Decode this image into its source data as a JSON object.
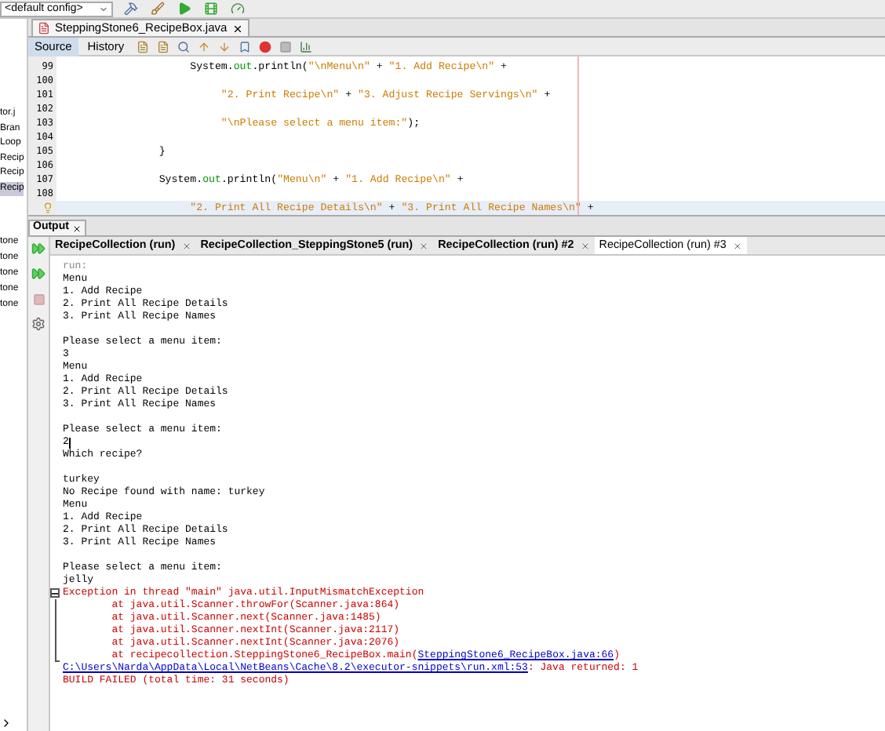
{
  "toolbar": {
    "config": "<default config>"
  },
  "project_tree": {
    "items": [
      {
        "label": "tor.j",
        "selected": false
      },
      {
        "label": "Bran",
        "selected": false
      },
      {
        "label": "Loop",
        "selected": false
      },
      {
        "label": "Recip",
        "selected": false
      },
      {
        "label": "Recip",
        "selected": false
      },
      {
        "label": "Recip",
        "selected": true
      }
    ],
    "lower_items": [
      "tone",
      "tone",
      "tone",
      "tone",
      "tone"
    ]
  },
  "editor": {
    "tab": "SteppingStone6_RecipeBox.java",
    "views": [
      {
        "label": "Source",
        "selected": true
      },
      {
        "label": "History",
        "selected": false
      }
    ],
    "lines": [
      {
        "number": "99",
        "current": false,
        "tokens": [
          {
            "kind": "plain",
            "text": "                    System."
          },
          {
            "kind": "field",
            "text": "out"
          },
          {
            "kind": "plain",
            "text": ".println("
          },
          {
            "kind": "string",
            "text": "\"\\nMenu\\n\""
          },
          {
            "kind": "plain",
            "text": " + "
          },
          {
            "kind": "string",
            "text": "\"1. Add Recipe\\n\""
          },
          {
            "kind": "plain",
            "text": " +"
          }
        ]
      },
      {
        "number": "100",
        "current": false
      },
      {
        "number": "101",
        "current": false,
        "tokens": [
          {
            "kind": "string",
            "text": "                         \"2. Print Recipe\\n\""
          },
          {
            "kind": "plain",
            "text": " + "
          },
          {
            "kind": "string",
            "text": "\"3. Adjust Recipe Servings\\n\""
          },
          {
            "kind": "plain",
            "text": " +"
          }
        ]
      },
      {
        "number": "102",
        "current": false
      },
      {
        "number": "103",
        "current": false,
        "tokens": [
          {
            "kind": "string",
            "text": "                         \"\\nPlease select a menu item:\""
          },
          {
            "kind": "plain",
            "text": ");"
          }
        ]
      },
      {
        "number": "104",
        "current": false
      },
      {
        "number": "105",
        "current": false,
        "tokens": [
          {
            "kind": "plain",
            "text": "               }"
          }
        ]
      },
      {
        "number": "106",
        "current": false
      },
      {
        "number": "107",
        "current": false,
        "tokens": [
          {
            "kind": "plain",
            "text": "               System."
          },
          {
            "kind": "field",
            "text": "out"
          },
          {
            "kind": "plain",
            "text": ".println("
          },
          {
            "kind": "string",
            "text": "\"Menu\\n\""
          },
          {
            "kind": "plain",
            "text": " + "
          },
          {
            "kind": "string",
            "text": "\"1. Add Recipe\\n\""
          },
          {
            "kind": "plain",
            "text": " +"
          }
        ]
      },
      {
        "number": "108",
        "current": false
      },
      {
        "current": true,
        "tokens": [
          {
            "kind": "string",
            "text": "                    \"2. Print All Recipe Details\\n\""
          },
          {
            "kind": "plain",
            "text": " + "
          },
          {
            "kind": "string",
            "text": "\"3. Print All Recipe Names\\n\""
          },
          {
            "kind": "plain",
            "text": " +"
          }
        ]
      }
    ]
  },
  "output": {
    "title": "Output",
    "tabs": [
      {
        "label": "RecipeCollection (run)",
        "selected": false
      },
      {
        "label": "RecipeCollection_SteppingStone5 (run)",
        "selected": false
      },
      {
        "label": "RecipeCollection (run) #2",
        "selected": false
      },
      {
        "label": "RecipeCollection (run) #3",
        "selected": true
      }
    ],
    "lines": [
      {
        "kind": "info",
        "segments": [
          {
            "kind": "info",
            "text": "run:"
          }
        ]
      },
      {
        "kind": "text",
        "segments": [
          {
            "kind": "text",
            "text": "Menu"
          }
        ]
      },
      {
        "kind": "text",
        "segments": [
          {
            "kind": "text",
            "text": "1. Add Recipe"
          }
        ]
      },
      {
        "kind": "text",
        "segments": [
          {
            "kind": "text",
            "text": "2. Print All Recipe Details"
          }
        ]
      },
      {
        "kind": "text",
        "segments": [
          {
            "kind": "text",
            "text": "3. Print All Recipe Names"
          }
        ]
      },
      {
        "kind": "blank"
      },
      {
        "kind": "text",
        "segments": [
          {
            "kind": "text",
            "text": "Please select a menu item:"
          }
        ]
      },
      {
        "kind": "text",
        "segments": [
          {
            "kind": "text",
            "text": "3"
          }
        ]
      },
      {
        "kind": "text",
        "segments": [
          {
            "kind": "text",
            "text": "Menu"
          }
        ]
      },
      {
        "kind": "text",
        "segments": [
          {
            "kind": "text",
            "text": "1. Add Recipe"
          }
        ]
      },
      {
        "kind": "text",
        "segments": [
          {
            "kind": "text",
            "text": "2. Print All Recipe Details"
          }
        ]
      },
      {
        "kind": "text",
        "segments": [
          {
            "kind": "text",
            "text": "3. Print All Recipe Names"
          }
        ]
      },
      {
        "kind": "blank"
      },
      {
        "kind": "text",
        "segments": [
          {
            "kind": "text",
            "text": "Please select a menu item:"
          }
        ]
      },
      {
        "kind": "input",
        "segments": [
          {
            "kind": "text",
            "text": "2"
          }
        ]
      },
      {
        "kind": "text",
        "segments": [
          {
            "kind": "text",
            "text": "Which recipe?"
          }
        ]
      },
      {
        "kind": "blank"
      },
      {
        "kind": "text",
        "segments": [
          {
            "kind": "text",
            "text": "turkey"
          }
        ]
      },
      {
        "kind": "text",
        "segments": [
          {
            "kind": "text",
            "text": "No Recipe found with name: turkey"
          }
        ]
      },
      {
        "kind": "text",
        "segments": [
          {
            "kind": "text",
            "text": "Menu"
          }
        ]
      },
      {
        "kind": "text",
        "segments": [
          {
            "kind": "text",
            "text": "1. Add Recipe"
          }
        ]
      },
      {
        "kind": "text",
        "segments": [
          {
            "kind": "text",
            "text": "2. Print All Recipe Details"
          }
        ]
      },
      {
        "kind": "text",
        "segments": [
          {
            "kind": "text",
            "text": "3. Print All Recipe Names"
          }
        ]
      },
      {
        "kind": "blank"
      },
      {
        "kind": "text",
        "segments": [
          {
            "kind": "text",
            "text": "Please select a menu item:"
          }
        ]
      },
      {
        "kind": "text",
        "segments": [
          {
            "kind": "text",
            "text": "jelly"
          }
        ]
      },
      {
        "kind": "fold",
        "segments": [
          {
            "kind": "error",
            "text": "Exception in thread \"main\" java.util.InputMismatchException"
          }
        ]
      },
      {
        "kind": "trace",
        "segments": [
          {
            "kind": "error",
            "text": "        at java.util.Scanner.throwFor(Scanner.java:864)"
          }
        ]
      },
      {
        "kind": "trace",
        "segments": [
          {
            "kind": "error",
            "text": "        at java.util.Scanner.next(Scanner.java:1485)"
          }
        ]
      },
      {
        "kind": "trace",
        "segments": [
          {
            "kind": "error",
            "text": "        at java.util.Scanner.nextInt(Scanner.java:2117)"
          }
        ]
      },
      {
        "kind": "trace",
        "segments": [
          {
            "kind": "error",
            "text": "        at java.util.Scanner.nextInt(Scanner.java:2076)"
          }
        ]
      },
      {
        "kind": "trace_end",
        "segments": [
          {
            "kind": "error",
            "text": "        at recipecollection.SteppingStone6_RecipeBox.main("
          },
          {
            "kind": "link",
            "text": "SteppingStone6_RecipeBox.java:66"
          },
          {
            "kind": "error",
            "text": ")"
          }
        ]
      },
      {
        "kind": "text",
        "segments": [
          {
            "kind": "link",
            "text": "C:\\Users\\Narda\\AppData\\Local\\NetBeans\\Cache\\8.2\\executor-snippets\\run.xml:53"
          },
          {
            "kind": "error",
            "text": ": Java returned: 1"
          }
        ]
      },
      {
        "kind": "text",
        "segments": [
          {
            "kind": "error",
            "text": "BUILD FAILED (total time: 31 seconds)"
          }
        ]
      }
    ]
  }
}
